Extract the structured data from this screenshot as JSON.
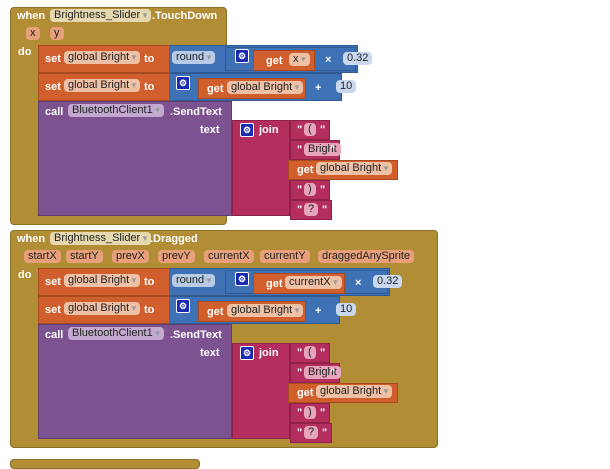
{
  "events": [
    {
      "when": "when",
      "component": "Brightness_Slider",
      "event": ".TouchDown",
      "params": [
        "x",
        "y"
      ],
      "do": "do",
      "set1": {
        "set": "set",
        "var": "global Bright",
        "to": "to",
        "round": "round",
        "get": "get",
        "get_var": "x",
        "op": "×",
        "num": "0.32"
      },
      "set2": {
        "set": "set",
        "var": "global Bright",
        "to": "to",
        "get": "get",
        "get_var": "global Bright",
        "op": "+",
        "num": "10"
      },
      "call": {
        "call": "call",
        "component": "BluetoothClient1",
        "method": ".SendText",
        "arg": "text",
        "join": "join",
        "items": [
          "(",
          "Bright",
          ")",
          "?"
        ],
        "get": "get",
        "get_var": "global Bright"
      }
    },
    {
      "when": "when",
      "component": "Brightness_Slider",
      "event": ".Dragged",
      "params": [
        "startX",
        "startY",
        "prevX",
        "prevY",
        "currentX",
        "currentY",
        "draggedAnySprite"
      ],
      "do": "do",
      "set1": {
        "set": "set",
        "var": "global Bright",
        "to": "to",
        "round": "round",
        "get": "get",
        "get_var": "currentX",
        "op": "×",
        "num": "0.32"
      },
      "set2": {
        "set": "set",
        "var": "global Bright",
        "to": "to",
        "get": "get",
        "get_var": "global Bright",
        "op": "+",
        "num": "10"
      },
      "call": {
        "call": "call",
        "component": "BluetoothClient1",
        "method": ".SendText",
        "arg": "text",
        "join": "join",
        "items": [
          "(",
          "Bright",
          ")",
          "?"
        ],
        "get": "get",
        "get_var": "global Bright"
      }
    }
  ],
  "colors": {
    "event": "#b18e35",
    "set": "#d05f2d",
    "math": "#3f71b5",
    "call": "#7d5290",
    "join": "#b32d5e"
  }
}
